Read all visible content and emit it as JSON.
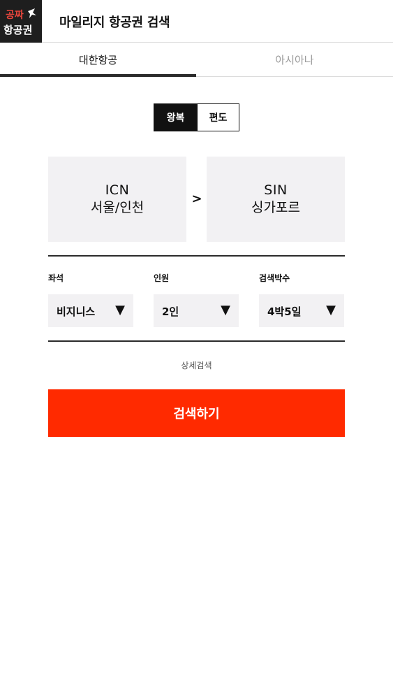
{
  "header": {
    "logo_text_top": "공짜",
    "logo_text_bottom": "항공권",
    "title": "마일리지 항공권 검색"
  },
  "tabs": [
    {
      "label": "대한항공",
      "active": true
    },
    {
      "label": "아시아나",
      "active": false
    }
  ],
  "trip_type": {
    "options": [
      "왕복",
      "편도"
    ],
    "selected": "왕복"
  },
  "route": {
    "from": {
      "code": "ICN",
      "city": "서울/인천"
    },
    "arrow": ">",
    "to": {
      "code": "SIN",
      "city": "싱가포르"
    }
  },
  "filters": [
    {
      "label": "좌석",
      "value": "비지니스"
    },
    {
      "label": "인원",
      "value": "2인"
    },
    {
      "label": "검색박수",
      "value": "4박5일"
    }
  ],
  "caret_glyph": "▼",
  "detail_search_label": "상세검색",
  "search_button_label": "검색하기",
  "colors": {
    "accent": "#ff2a00",
    "field_bg": "#f2f1f3",
    "dark": "#111111"
  }
}
